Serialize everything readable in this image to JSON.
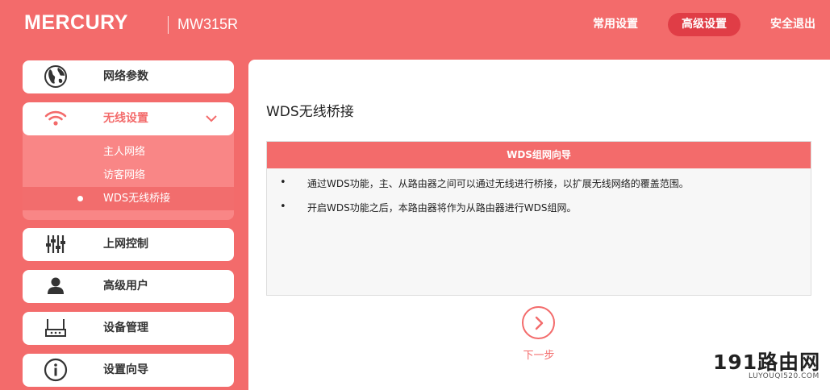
{
  "header": {
    "brand": "MERCURY",
    "model": "MW315R",
    "nav": [
      "常用设置",
      "高级设置",
      "安全退出"
    ]
  },
  "sidebar": {
    "items": [
      {
        "label": "网络参数",
        "icon": "globe-icon"
      },
      {
        "label": "无线设置",
        "icon": "wifi-icon",
        "expanded": true,
        "children": [
          "主人网络",
          "访客网络",
          "WDS无线桥接"
        ],
        "active_child": "WDS无线桥接"
      },
      {
        "label": "上网控制",
        "icon": "sliders-icon"
      },
      {
        "label": "高级用户",
        "icon": "user-icon"
      },
      {
        "label": "设备管理",
        "icon": "router-icon"
      },
      {
        "label": "设置向导",
        "icon": "info-icon"
      }
    ]
  },
  "main": {
    "title": "WDS无线桥接",
    "wizard_header": "WDS组网向导",
    "bullets": [
      "通过WDS功能，主、从路由器之间可以通过无线进行桥接，以扩展无线网络的覆盖范围。",
      "开启WDS功能之后，本路由器将作为从路由器进行WDS组网。"
    ],
    "next_label": "下一步"
  },
  "watermark": {
    "text": "191路由网",
    "url": "LUYOUQI520.COM"
  },
  "colors": {
    "accent": "#f36b6b",
    "active_nav": "#e03d46",
    "submenu_bg": "#f98686"
  }
}
